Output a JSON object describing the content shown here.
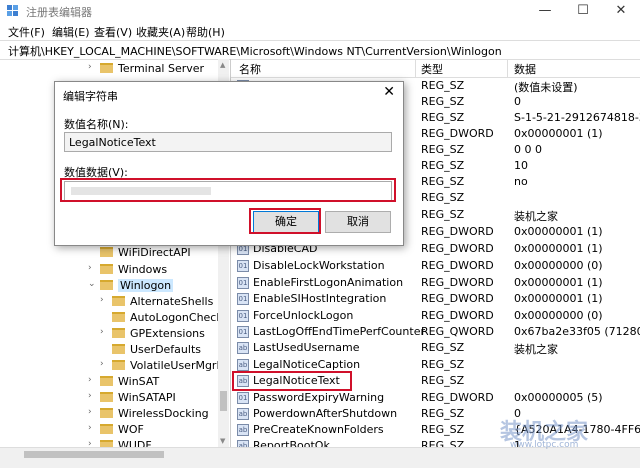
{
  "window": {
    "title": "注册表编辑器",
    "min": "—",
    "max": "☐",
    "close": "✕"
  },
  "menu": [
    "文件(F)",
    "编辑(E)",
    "查看(V)",
    "收藏夹(A)",
    "帮助(H)"
  ],
  "address": "计算机\\HKEY_LOCAL_MACHINE\\SOFTWARE\\Microsoft\\Windows NT\\CurrentVersion\\Winlogon",
  "tree": [
    {
      "label": "Terminal Server",
      "arrow": "›",
      "depth": 0
    },
    {
      "label": "WiFiDirectAPI",
      "arrow": "",
      "depth": 0
    },
    {
      "label": "Windows",
      "arrow": "›",
      "depth": 0
    },
    {
      "label": "Winlogon",
      "arrow": "⌄",
      "depth": 0,
      "selected": true
    },
    {
      "label": "AlternateShells",
      "arrow": "›",
      "depth": 1
    },
    {
      "label": "AutoLogonChecked",
      "arrow": "",
      "depth": 1
    },
    {
      "label": "GPExtensions",
      "arrow": "›",
      "depth": 1
    },
    {
      "label": "UserDefaults",
      "arrow": "",
      "depth": 1
    },
    {
      "label": "VolatileUserMgrKey",
      "arrow": "›",
      "depth": 1
    },
    {
      "label": "WinSAT",
      "arrow": "›",
      "depth": 0
    },
    {
      "label": "WinSATAPI",
      "arrow": "›",
      "depth": 0
    },
    {
      "label": "WirelessDocking",
      "arrow": "›",
      "depth": 0
    },
    {
      "label": "WOF",
      "arrow": "›",
      "depth": 0
    },
    {
      "label": "WUDF",
      "arrow": "›",
      "depth": 0
    }
  ],
  "columns": {
    "name": "名称",
    "type": "类型",
    "data": "数据"
  },
  "rows": [
    {
      "name": "",
      "type": "REG_SZ",
      "data": "(数值未设置)"
    },
    {
      "name": "",
      "type": "REG_SZ",
      "data": "0"
    },
    {
      "name": "",
      "type": "REG_SZ",
      "data": "S-1-5-21-2912674818-3"
    },
    {
      "name": "",
      "type": "REG_DWORD",
      "data": "0x00000001 (1)"
    },
    {
      "name": "",
      "type": "REG_SZ",
      "data": "0 0 0"
    },
    {
      "name": "",
      "type": "REG_SZ",
      "data": "10"
    },
    {
      "name": "",
      "type": "REG_SZ",
      "data": "no"
    },
    {
      "name": "",
      "type": "REG_SZ",
      "data": ""
    },
    {
      "name": "",
      "type": "REG_SZ",
      "data": "装机之家"
    },
    {
      "name": "",
      "type": "REG_DWORD",
      "data": "0x00000001 (1)"
    },
    {
      "name": "DisableCAD",
      "type": "REG_DWORD",
      "data": "0x00000001 (1)"
    },
    {
      "name": "DisableLockWorkstation",
      "type": "REG_DWORD",
      "data": "0x00000000 (0)"
    },
    {
      "name": "EnableFirstLogonAnimation",
      "type": "REG_DWORD",
      "data": "0x00000001 (1)"
    },
    {
      "name": "EnableSIHostIntegration",
      "type": "REG_DWORD",
      "data": "0x00000001 (1)"
    },
    {
      "name": "ForceUnlockLogon",
      "type": "REG_DWORD",
      "data": "0x00000000 (0)"
    },
    {
      "name": "LastLogOffEndTimePerfCounter",
      "type": "REG_QWORD",
      "data": "0x67ba2e33f05 (712808"
    },
    {
      "name": "LastUsedUsername",
      "type": "REG_SZ",
      "data": "装机之家"
    },
    {
      "name": "LegalNoticeCaption",
      "type": "REG_SZ",
      "data": ""
    },
    {
      "name": "LegalNoticeText",
      "type": "REG_SZ",
      "data": ""
    },
    {
      "name": "PasswordExpiryWarning",
      "type": "REG_DWORD",
      "data": "0x00000005 (5)"
    },
    {
      "name": "PowerdownAfterShutdown",
      "type": "REG_SZ",
      "data": "0"
    },
    {
      "name": "PreCreateKnownFolders",
      "type": "REG_SZ",
      "data": "{A520A1A4-1780-4FF6-"
    },
    {
      "name": "ReportBootOk",
      "type": "REG_SZ",
      "data": "1"
    }
  ],
  "dialog": {
    "title": "编辑字符串",
    "close": "✕",
    "name_label": "数值名称(N):",
    "name_value": "LegalNoticeText",
    "data_label": "数值数据(V):",
    "data_value": "",
    "ok": "确定",
    "cancel": "取消"
  },
  "watermark": {
    "text": "装机之家",
    "url": "www.lotpc.com"
  }
}
